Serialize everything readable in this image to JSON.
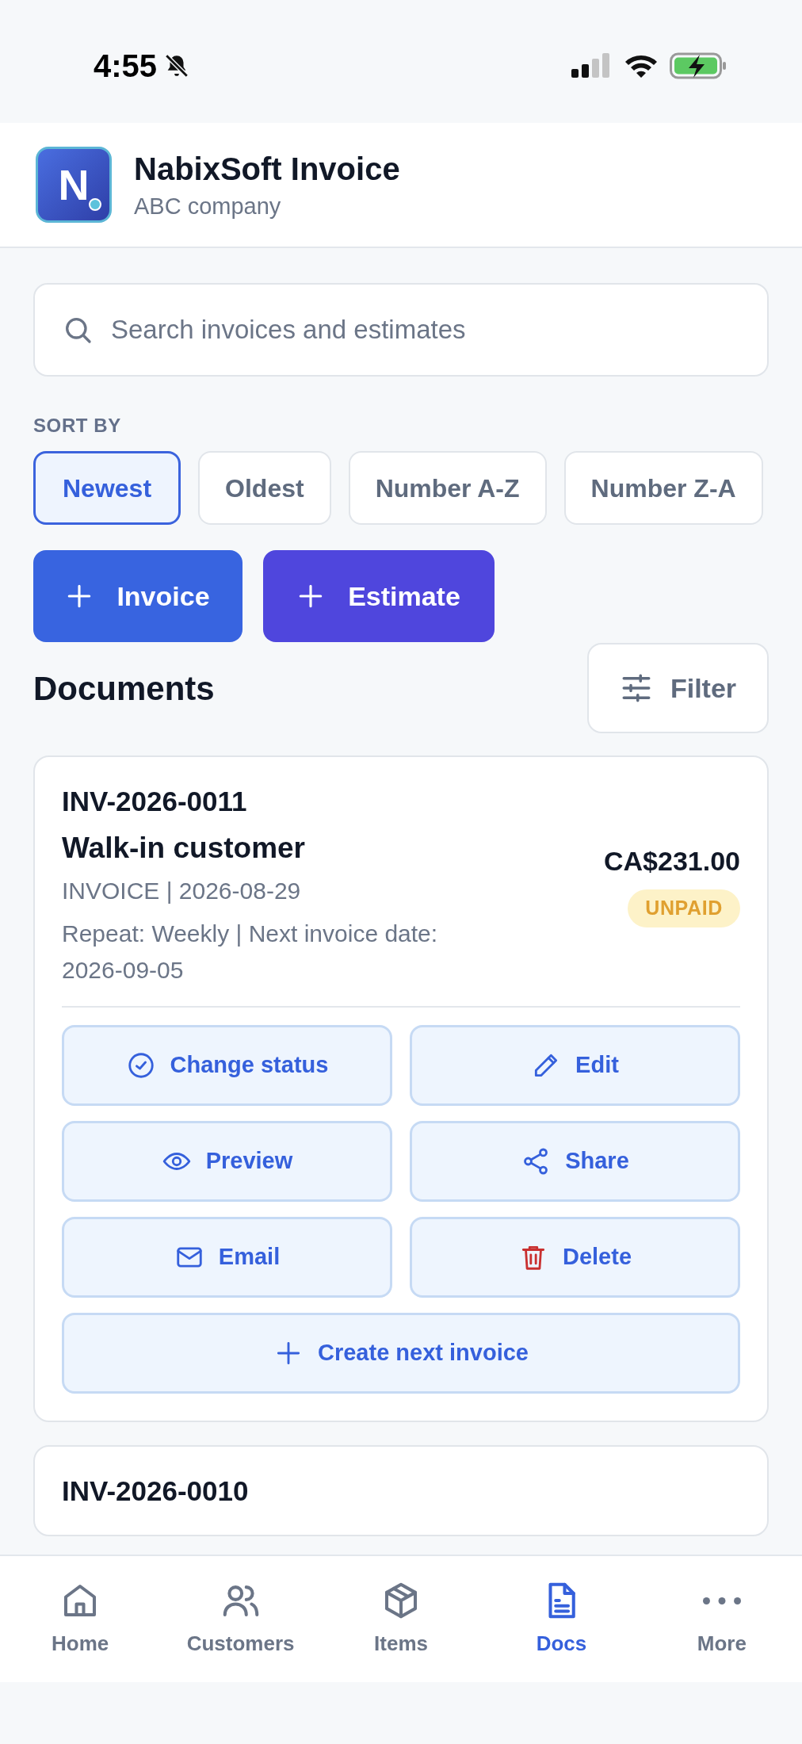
{
  "status_bar": {
    "time": "4:55"
  },
  "app": {
    "logo_letter": "N",
    "title": "NabixSoft Invoice",
    "subtitle": "ABC company"
  },
  "search": {
    "placeholder": "Search invoices and estimates"
  },
  "sort": {
    "label": "SORT BY",
    "options": [
      {
        "label": "Newest",
        "selected": true
      },
      {
        "label": "Oldest",
        "selected": false
      },
      {
        "label": "Number A-Z",
        "selected": false
      },
      {
        "label": "Number Z-A",
        "selected": false
      }
    ]
  },
  "create_buttons": [
    {
      "kind": "invoice",
      "label": "Invoice"
    },
    {
      "kind": "estimate",
      "label": "Estimate"
    }
  ],
  "documents": {
    "title": "Documents",
    "filter_label": "Filter",
    "items": [
      {
        "id": "INV-2026-0011",
        "customer": "Walk-in customer",
        "meta": "INVOICE | 2026-08-29",
        "repeat": "Repeat: Weekly | Next invoice date: 2026-09-05",
        "amount": "CA$231.00",
        "status": "UNPAID",
        "actions": [
          {
            "label": "Change status"
          },
          {
            "label": "Edit"
          },
          {
            "label": "Preview"
          },
          {
            "label": "Share"
          },
          {
            "label": "Email"
          },
          {
            "label": "Delete"
          },
          {
            "label": "Create next invoice"
          }
        ]
      },
      {
        "id": "INV-2026-0010"
      }
    ]
  },
  "nav": [
    {
      "label": "Home",
      "selected": false
    },
    {
      "label": "Customers",
      "selected": false
    },
    {
      "label": "Items",
      "selected": false
    },
    {
      "label": "Docs",
      "selected": true
    },
    {
      "label": "More",
      "selected": false
    }
  ]
}
